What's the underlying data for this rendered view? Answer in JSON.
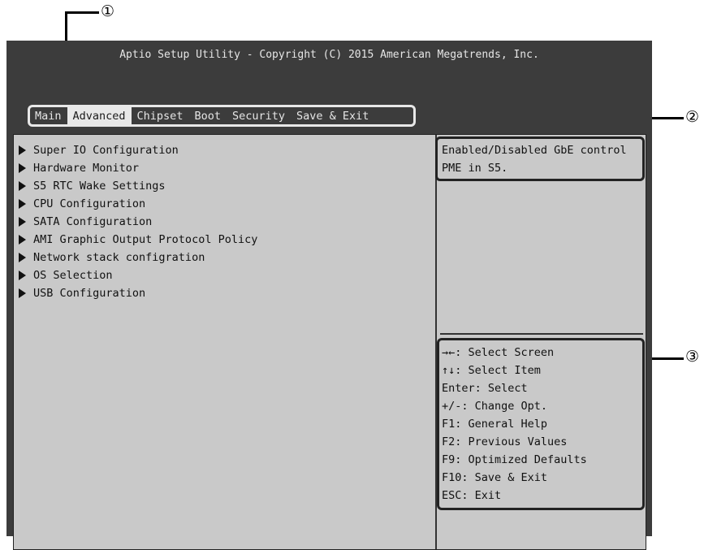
{
  "callouts": {
    "one": "①",
    "two": "②",
    "three": "③"
  },
  "title": "Aptio Setup Utility - Copyright (C) 2015 American Megatrends, Inc.",
  "tabs": [
    {
      "label": "Main"
    },
    {
      "label": "Advanced",
      "active": true
    },
    {
      "label": "Chipset"
    },
    {
      "label": "Boot"
    },
    {
      "label": "Security"
    },
    {
      "label": "Save & Exit"
    }
  ],
  "menu": [
    "Super IO Configuration",
    "Hardware Monitor",
    "S5 RTC Wake Settings",
    "CPU Configuration",
    "SATA Configuration",
    "AMI Graphic Output Protocol Policy",
    "Network stack configration",
    "OS Selection",
    "USB Configuration"
  ],
  "help_text": "Enabled/Disabled GbE control\nPME in S5.",
  "keys": [
    "→←: Select Screen",
    "↑↓: Select Item",
    "Enter: Select",
    "+/-: Change Opt.",
    "F1: General Help",
    "F2: Previous Values",
    "F9: Optimized Defaults",
    "F10: Save & Exit",
    "ESC: Exit"
  ],
  "colors": {
    "frame": "#3c3c3c",
    "panel": "#c9c9c9",
    "highlight": "#e8e8e8"
  }
}
